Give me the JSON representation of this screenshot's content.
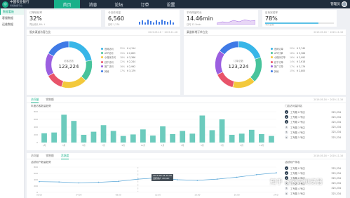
{
  "app": {
    "title": "中国农业银行",
    "subtitle": "智能数据平台"
  },
  "nav": [
    {
      "label": "首页"
    },
    {
      "label": "消息"
    },
    {
      "label": "论坛"
    },
    {
      "label": "订单"
    },
    {
      "label": "设置"
    }
  ],
  "user": {
    "name": "管理员"
  },
  "sidebar": [
    {
      "label": "数据看板"
    },
    {
      "label": "客服数据"
    },
    {
      "label": "运维数据"
    }
  ],
  "stats": [
    {
      "label": "订单转化率",
      "value": "32%",
      "foot": "同比增长 8% ↑"
    },
    {
      "label": "今日访问量",
      "value": "6,560",
      "foot": "日均 1,234"
    },
    {
      "label": "平均停留时长",
      "value": "14.46min",
      "foot": "日均 12.5min"
    },
    {
      "label": "目标完成率",
      "value": "78%",
      "foot": "本月目标",
      "progress": 0.78
    }
  ],
  "donut_cards": [
    {
      "title": "服务渠道访客占比",
      "meta": "2019-05-16 ~ 2019-11-16",
      "center_label": "访客总数",
      "total": "123,224"
    },
    {
      "title": "渠道新增订单占比",
      "meta": "2019-05-16 ~ 2019-11-16",
      "center_label": "订单总数",
      "total": "123,224"
    }
  ],
  "bar_card": {
    "tabs": [
      "访问量",
      "销售额"
    ],
    "meta": "2019-05-16 ~ 2019-11-16",
    "chart_title": "年度访客数量趋势",
    "rank_title": "门店访问量排名"
  },
  "line_card": {
    "tabs": [
      "访问量",
      "销售额",
      "活跃度"
    ],
    "meta": "2019-05-16 ~ 2019-11-16",
    "chart_title": "活跃用户数量趋势",
    "rank_title": "活跃用户排名",
    "tooltip_time": "2019-06-16 10:00",
    "tooltip_value": "活跃用户 18,620"
  },
  "rank": [
    "工专路 0 号店",
    "工专路 1 号店",
    "工专路 2 号店",
    "工专路 3 号店",
    "工专路 4 号店",
    "工专路 5 号店"
  ],
  "rank_value": "323,234",
  "watermark": {
    "text": "知乎 @蒙蒂浏览器"
  },
  "colors": {
    "accent": "#18b08a",
    "topbar": "#1f2d3d",
    "bar": "#6ccbbd",
    "line": "#5aa7d8"
  },
  "chart_data": [
    {
      "type": "pie",
      "title": "服务渠道访客占比",
      "categories": [
        "官网访问",
        "APP访问",
        "小程序访问",
        "线下访问",
        "推广访问",
        "其他"
      ],
      "values": [
        22,
        15,
        18,
        12,
        16,
        17
      ],
      "colors": [
        "#38b6e8",
        "#47c39b",
        "#f3c93c",
        "#e8546a",
        "#9b5fe0",
        "#3f7ae6"
      ]
    },
    {
      "type": "pie",
      "title": "渠道新增订单占比",
      "categories": [
        "官网订单",
        "APP订单",
        "小程序订单",
        "线下订单",
        "推广订单",
        "其他"
      ],
      "values": [
        20,
        18,
        16,
        14,
        17,
        15
      ],
      "colors": [
        "#38b6e8",
        "#47c39b",
        "#f3c93c",
        "#e8546a",
        "#9b5fe0",
        "#3f7ae6"
      ]
    },
    {
      "type": "bar",
      "title": "年度访客数量趋势",
      "categories": [
        "1月",
        "2月",
        "3月",
        "4月",
        "5月",
        "6月",
        "7月",
        "8月",
        "9月",
        "10月",
        "11月",
        "12月",
        "1月",
        "2月",
        "3月",
        "4月",
        "5月",
        "6月",
        "7月",
        "8月",
        "9月",
        "10月",
        "11月",
        "12月"
      ],
      "values": [
        240,
        260,
        720,
        560,
        200,
        280,
        450,
        300,
        170,
        210,
        340,
        180,
        420,
        220,
        300,
        230,
        700,
        320,
        600,
        200,
        230,
        330,
        220,
        170
      ],
      "ylim": [
        0,
        800
      ],
      "yticks": [
        0,
        200,
        400,
        600,
        800
      ]
    },
    {
      "type": "line",
      "title": "活跃用户数量趋势",
      "x": [
        "00:00",
        "02:00",
        "04:00",
        "06:00",
        "08:00",
        "10:00",
        "12:00",
        "14:00",
        "16:00",
        "18:00",
        "20:00",
        "22:00",
        "24:00"
      ],
      "series": [
        {
          "values": [
            340,
            330,
            300,
            320,
            350,
            420,
            460,
            400,
            380,
            420,
            480,
            560,
            620
          ]
        }
      ],
      "ylim": [
        0,
        800
      ],
      "yticks": [
        0,
        200,
        400,
        600,
        800
      ]
    }
  ]
}
